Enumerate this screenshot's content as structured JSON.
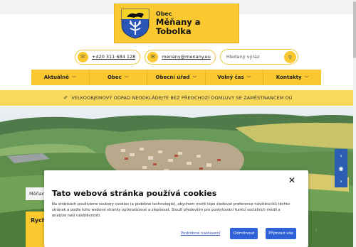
{
  "header": {
    "logo_small": "Obec",
    "logo_name": "Měňany a Tobolka"
  },
  "contacts": {
    "phone": "+420 311 684 128",
    "email": "menany@menany.eu",
    "search_placeholder": "Hledaný výraz"
  },
  "nav": {
    "items": [
      {
        "label": "Aktuálně"
      },
      {
        "label": "Obec"
      },
      {
        "label": "Obecní úřad"
      },
      {
        "label": "Volný čas"
      },
      {
        "label": "Kontakty"
      }
    ]
  },
  "notice": {
    "text": "VELKOOBJEMOVÝ ODPAD NEODKLÁDEJTE BEZ PŘEDCHOZÍ DOMLUVY SE ZAMĚSTNANCEM OÚ"
  },
  "page": {
    "breadcrumb": "Měňan",
    "quick_title": "Rych"
  },
  "cookies": {
    "title": "Tato webová stránka používá cookies",
    "body": "Na stránkách používáme soubory cookies (a podobné technologie), abychom mohli lépe sledovat preference návštěvníků těchto stránek a podle toho webové stránky optimalizovat a zlepšovat. Slouží především pro poskytování funkcí sociálních médií a analýze naší návštěvnosti.",
    "settings_link": "Podrobné nastavení",
    "reject_label": "Odmítnout",
    "accept_label": "Přijmout vše"
  },
  "colors": {
    "accent": "#f9c92f",
    "banner": "#f9d95a",
    "button": "#2f62d8",
    "slider_control": "#2b5db3"
  }
}
